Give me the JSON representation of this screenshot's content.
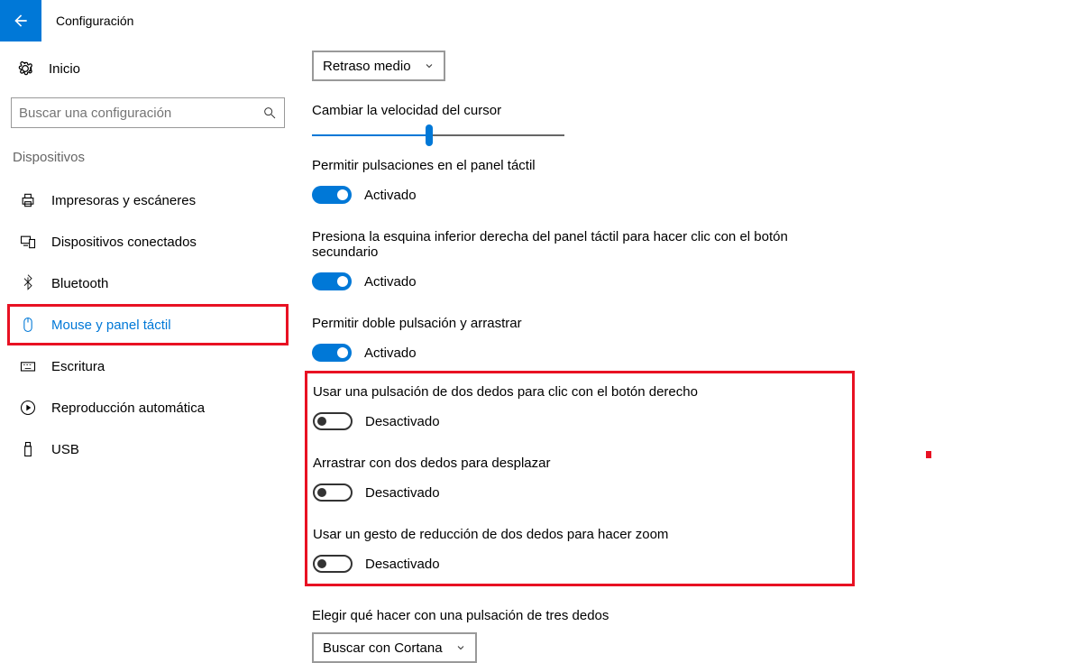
{
  "header": {
    "title": "Configuración"
  },
  "sidebar": {
    "home": "Inicio",
    "search_placeholder": "Buscar una configuración",
    "category": "Dispositivos",
    "items": [
      {
        "label": "Impresoras y escáneres"
      },
      {
        "label": "Dispositivos conectados"
      },
      {
        "label": "Bluetooth"
      },
      {
        "label": "Mouse y panel táctil"
      },
      {
        "label": "Escritura"
      },
      {
        "label": "Reproducción automática"
      },
      {
        "label": "USB"
      }
    ]
  },
  "main": {
    "delay_dropdown": "Retraso medio",
    "cursor_speed_label": "Cambiar la velocidad del cursor",
    "toggles": {
      "allow_taps": {
        "label": "Permitir pulsaciones en el panel táctil",
        "state": "Activado"
      },
      "corner_click": {
        "label": "Presiona la esquina inferior derecha del panel táctil para hacer clic con el botón secundario",
        "state": "Activado"
      },
      "double_tap_drag": {
        "label": "Permitir doble pulsación y arrastrar",
        "state": "Activado"
      },
      "two_finger_right": {
        "label": "Usar una pulsación de dos dedos para clic con el botón derecho",
        "state": "Desactivado"
      },
      "two_finger_scroll": {
        "label": "Arrastrar con dos dedos para desplazar",
        "state": "Desactivado"
      },
      "two_finger_zoom": {
        "label": "Usar un gesto de reducción de dos dedos para hacer zoom",
        "state": "Desactivado"
      }
    },
    "three_finger": {
      "label": "Elegir qué hacer con una pulsación de tres dedos",
      "selected": "Buscar con Cortana"
    },
    "state_on": "Activado",
    "state_off": "Desactivado"
  }
}
